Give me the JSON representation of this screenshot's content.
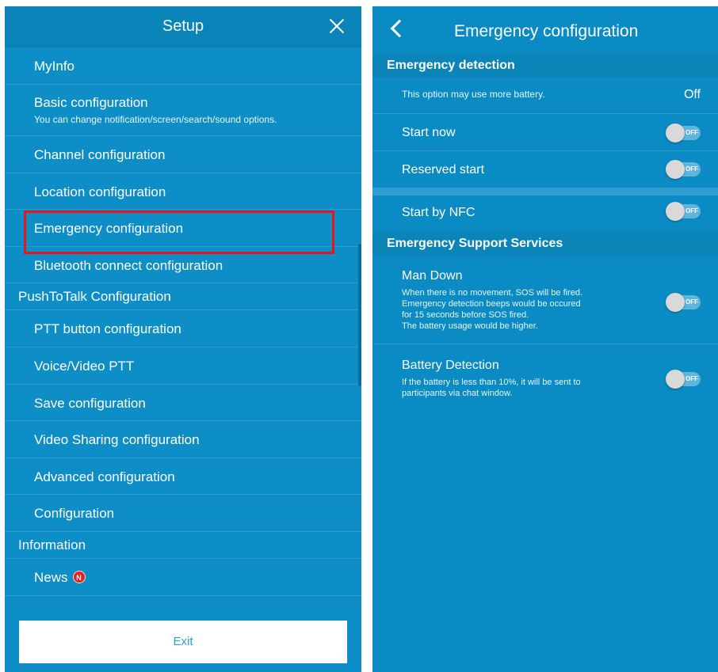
{
  "setup": {
    "title": "Setup",
    "items": [
      {
        "label": "MyInfo"
      },
      {
        "label": "Basic configuration",
        "sub": "You can change notification/screen/search/sound options."
      },
      {
        "label": "Channel configuration"
      },
      {
        "label": "Location configuration"
      },
      {
        "label": "Emergency configuration"
      },
      {
        "label": "Bluetooth connect configuration"
      }
    ],
    "ptt_section": "PushToTalk Configuration",
    "ptt_items": [
      {
        "label": "PTT button configuration"
      },
      {
        "label": "Voice/Video PTT"
      },
      {
        "label": "Save configuration"
      },
      {
        "label": "Video Sharing configuration"
      },
      {
        "label": "Advanced configuration"
      },
      {
        "label": "Configuration"
      }
    ],
    "info_section": "Information",
    "news_label": "News",
    "news_badge": "N",
    "exit_label": "Exit"
  },
  "emergency": {
    "title": "Emergency configuration",
    "detection_header": "Emergency detection",
    "battery_note": "This option may use more battery.",
    "battery_note_value": "Off",
    "start_now": "Start now",
    "reserved_start": "Reserved start",
    "start_by_nfc": "Start by NFC",
    "support_header": "Emergency Support Services",
    "man_down": {
      "label": "Man Down",
      "desc": [
        "When there is no movement, SOS will be fired.",
        "Emergency detection beeps would be occured",
        "for 15 seconds before SOS fired.",
        "The battery usage would be higher."
      ]
    },
    "battery_detection": {
      "label": "Battery Detection",
      "desc": [
        "If the battery is less than 10%, it will be sent to",
        "participants via chat window."
      ]
    },
    "toggle_off_text": "OFF"
  },
  "colors": {
    "panel_bg": "#0e8ec6",
    "highlight": "#e8151b",
    "badge": "#e02424"
  }
}
